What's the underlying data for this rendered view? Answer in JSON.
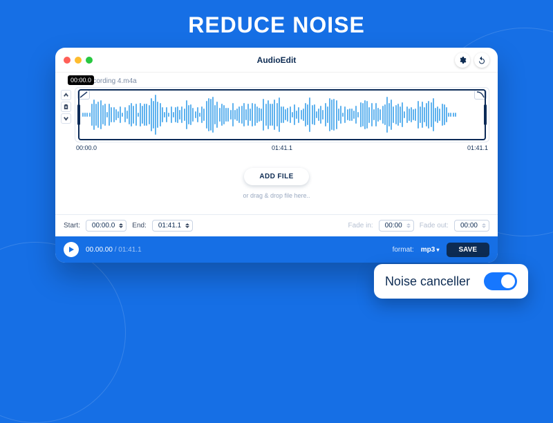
{
  "hero": {
    "title": "REDUCE NOISE"
  },
  "window": {
    "app_title": "AudioEdit",
    "file_tab": "ew Recording 4.m4a",
    "hover_timestamp": "00:00.0"
  },
  "timeline": {
    "start": "00:00.0",
    "mid": "01:41.1",
    "end": "01:41.1"
  },
  "dropzone": {
    "button": "ADD FILE",
    "hint": "or drag & drop file here.."
  },
  "toolbar": {
    "start_label": "Start:",
    "start_value": "00:00.0",
    "end_label": "End:",
    "end_value": "01:41.1",
    "fadein_label": "Fade in:",
    "fadein_value": "00:00",
    "fadeout_label": "Fade out:",
    "fadeout_value": "00:00"
  },
  "playbar": {
    "current": "00.00.00",
    "total": "01:41.1",
    "format_label": "format:",
    "format_value": "mp3",
    "save": "SAVE"
  },
  "feature": {
    "label": "Noise canceller",
    "enabled": true
  }
}
